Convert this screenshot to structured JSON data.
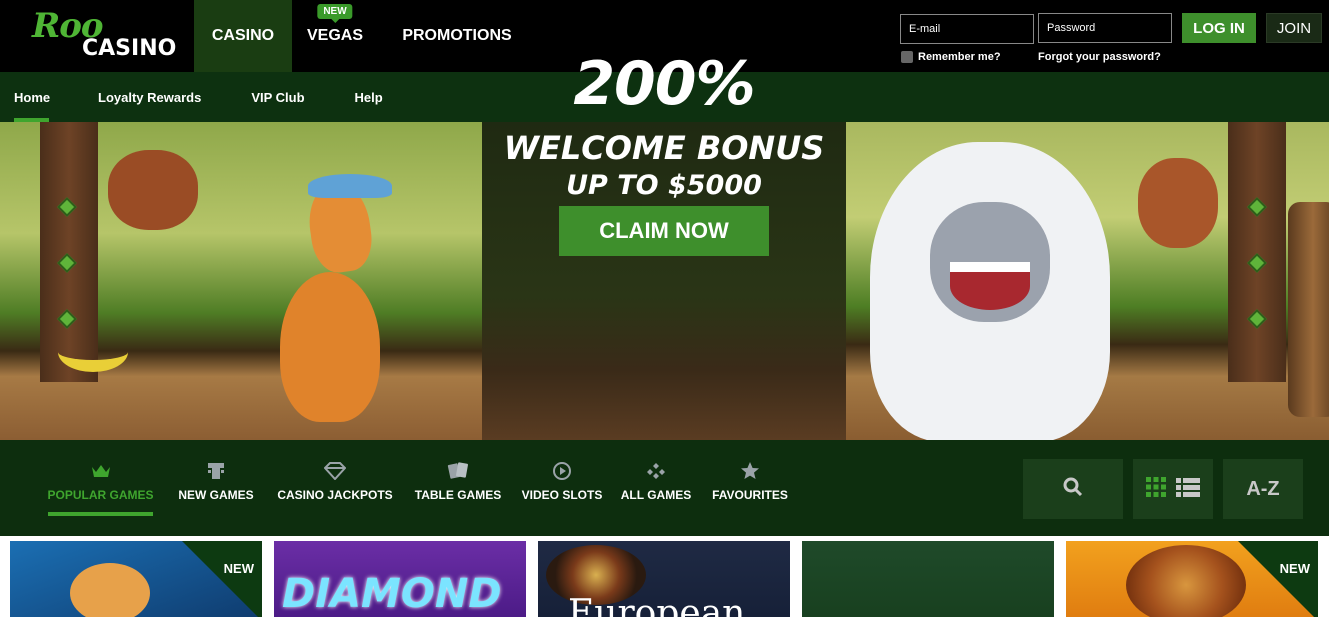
{
  "brand": {
    "logo_top": "Roo",
    "logo_bottom": "CASINO"
  },
  "main_nav": {
    "casino": "CASINO",
    "vegas": "VEGAS",
    "vegas_badge": "NEW",
    "promotions": "PROMOTIONS"
  },
  "login": {
    "email_placeholder": "E-mail",
    "password_placeholder": "Password",
    "login_button": "LOG IN",
    "join_button": "JOIN",
    "remember_label": "Remember me?",
    "forgot_link": "Forgot your password?"
  },
  "sub_nav": {
    "items": [
      "Home",
      "Loyalty Rewards",
      "VIP Club",
      "Help"
    ],
    "active": "Home"
  },
  "hero": {
    "headline": "200%",
    "subline": "WELCOME BONUS",
    "subline2": "UP TO $5000",
    "cta": "CLAIM NOW"
  },
  "categories": {
    "items": [
      {
        "label": "POPULAR GAMES",
        "icon": "crown-icon",
        "active": true
      },
      {
        "label": "NEW GAMES",
        "icon": "slot-machine-icon",
        "active": false
      },
      {
        "label": "CASINO JACKPOTS",
        "icon": "diamond-icon",
        "active": false
      },
      {
        "label": "TABLE GAMES",
        "icon": "cards-icon",
        "active": false
      },
      {
        "label": "VIDEO SLOTS",
        "icon": "play-icon",
        "active": false
      },
      {
        "label": "ALL GAMES",
        "icon": "clubs-icon",
        "active": false
      },
      {
        "label": "FAVOURITES",
        "icon": "star-icon",
        "active": false
      }
    ],
    "tools": {
      "az_label": "A-Z"
    }
  },
  "games": {
    "tiles": [
      {
        "badge": "NEW"
      },
      {
        "text": "DIAMOND"
      },
      {
        "text": "European"
      },
      {},
      {
        "badge": "NEW"
      }
    ]
  },
  "colors": {
    "accent_green": "#3e8f2c",
    "nav_dark_green": "#0d3110",
    "top_bar": "#000000"
  }
}
